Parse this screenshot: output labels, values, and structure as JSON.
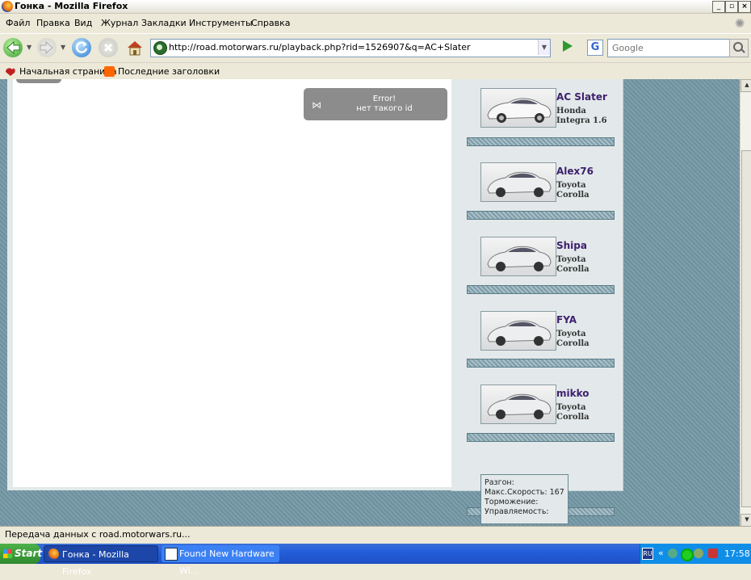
{
  "window": {
    "title": "Гонка - Mozilla Firefox",
    "min": "_",
    "max": "▫",
    "close": "×"
  },
  "menu": [
    "Файл",
    "Правка",
    "Вид",
    "Журнал",
    "Закладки",
    "Инструменты",
    "Справка"
  ],
  "nav": {
    "url": "http://road.motorwars.ru/playback.php?rid=1526907&q=AC+Slater",
    "search_placeholder": "Google",
    "search_engine": "G"
  },
  "bookmarks": [
    "Начальная страница",
    "Последние заголовки"
  ],
  "page": {
    "error_title": "Error!",
    "error_text": "нет такого id",
    "racers": [
      {
        "name": "AC Slater",
        "car_make": "Honda",
        "car_model": "Integra 1.6"
      },
      {
        "name": "Alex76",
        "car_make": "Toyota",
        "car_model": "Corolla"
      },
      {
        "name": "Shipa",
        "car_make": "Toyota",
        "car_model": "Corolla"
      },
      {
        "name": "FYA",
        "car_make": "Toyota",
        "car_model": "Corolla"
      },
      {
        "name": "mikko",
        "car_make": "Toyota",
        "car_model": "Corolla"
      }
    ],
    "tooltip": {
      "accel": "Разгон:",
      "maxspeed": "Макс.Скорость: 167",
      "braking": "Торможение:",
      "handling": "Управляемость:"
    }
  },
  "status": "Передача данных с road.motorwars.ru...",
  "taskbar": {
    "start": "Start",
    "tasks": [
      "Гонка - Mozilla Firefox",
      "Found New Hardware Wi..."
    ],
    "lang": "RU",
    "clock": "17:58"
  },
  "colors": {
    "page_bg": "#7d9fac",
    "panel": "#e3e9ea",
    "name": "#3d1f6e",
    "error_bg": "#8c8c8c"
  }
}
